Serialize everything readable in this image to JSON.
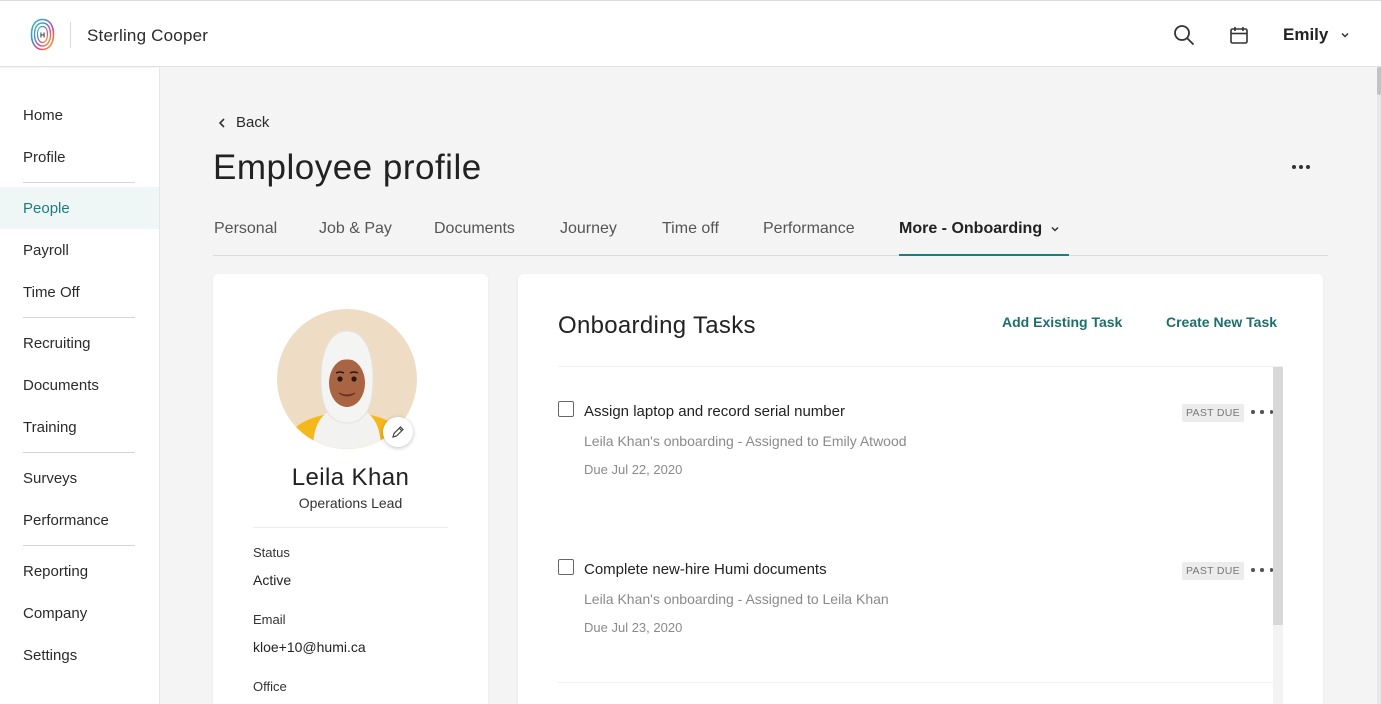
{
  "header": {
    "company": "Sterling Cooper",
    "user": "Emily",
    "icons": [
      "humi-logo-icon",
      "search-icon",
      "calendar-icon",
      "chevron-down-icon"
    ]
  },
  "sidebar": {
    "items": [
      {
        "label": "Home"
      },
      {
        "label": "Profile"
      },
      {
        "label": "People",
        "active": true
      },
      {
        "label": "Payroll"
      },
      {
        "label": "Time Off"
      },
      {
        "label": "Recruiting"
      },
      {
        "label": "Documents"
      },
      {
        "label": "Training"
      },
      {
        "label": "Surveys"
      },
      {
        "label": "Performance"
      },
      {
        "label": "Reporting"
      },
      {
        "label": "Company"
      },
      {
        "label": "Settings"
      }
    ]
  },
  "page": {
    "back_label": "Back",
    "title": "Employee profile",
    "tabs": [
      {
        "label": "Personal"
      },
      {
        "label": "Job & Pay"
      },
      {
        "label": "Documents"
      },
      {
        "label": "Journey"
      },
      {
        "label": "Time off"
      },
      {
        "label": "Performance"
      },
      {
        "label": "More - Onboarding",
        "active": true
      }
    ]
  },
  "profile": {
    "name": "Leila Khan",
    "role": "Operations Lead",
    "fields": [
      {
        "label": "Status",
        "value": "Active"
      },
      {
        "label": "Email",
        "value": "kloe+10@humi.ca"
      },
      {
        "label": "Office",
        "value": ""
      }
    ]
  },
  "onboarding": {
    "title": "Onboarding Tasks",
    "add_existing_label": "Add Existing Task",
    "create_new_label": "Create New Task",
    "tasks": [
      {
        "name": "Assign laptop and record serial number",
        "meta": "Leila Khan's onboarding - Assigned to Emily Atwood",
        "due": "Due Jul 22, 2020",
        "badge": "PAST DUE"
      },
      {
        "name": "Complete new-hire Humi documents",
        "meta": "Leila Khan's onboarding - Assigned to Leila Khan",
        "due": "Due Jul 23, 2020",
        "badge": "PAST DUE"
      }
    ]
  },
  "colors": {
    "accent": "#1d7d78",
    "link": "#1d6f6b",
    "active_nav_bg": "#eef7f6"
  }
}
